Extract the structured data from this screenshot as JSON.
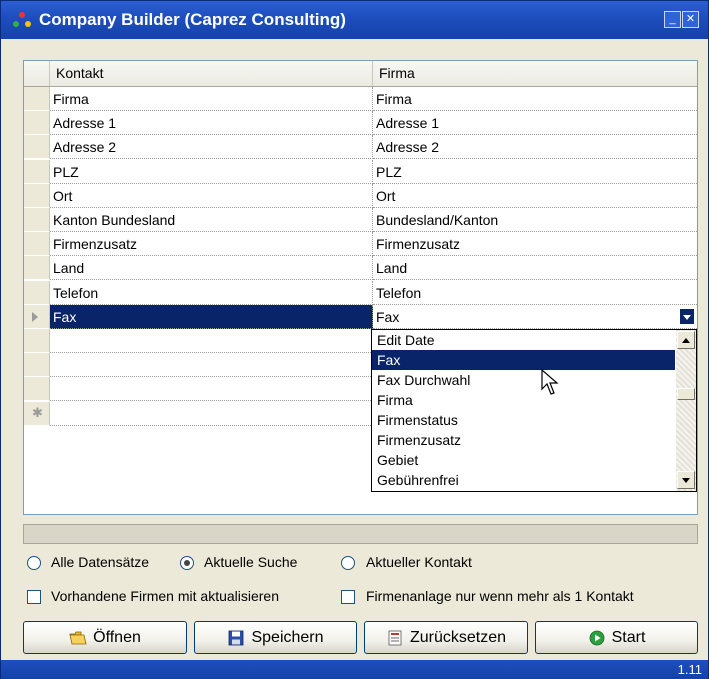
{
  "window": {
    "title": "Company Builder (Caprez Consulting)",
    "version": "1.11"
  },
  "grid": {
    "columns": [
      "Kontakt",
      "Firma"
    ],
    "rows": [
      {
        "kontakt": "Firma",
        "firma": "Firma"
      },
      {
        "kontakt": "Adresse 1",
        "firma": "Adresse 1"
      },
      {
        "kontakt": "Adresse 2",
        "firma": "Adresse 2"
      },
      {
        "kontakt": "PLZ",
        "firma": "PLZ"
      },
      {
        "kontakt": "Ort",
        "firma": "Ort"
      },
      {
        "kontakt": "Kanton Bundesland",
        "firma": "Bundesland/Kanton"
      },
      {
        "kontakt": "Firmenzusatz",
        "firma": "Firmenzusatz"
      },
      {
        "kontakt": "Land",
        "firma": "Land"
      },
      {
        "kontakt": "Telefon",
        "firma": "Telefon"
      },
      {
        "kontakt": "Fax",
        "firma": "Fax"
      },
      {
        "kontakt": "",
        "firma": ""
      },
      {
        "kontakt": "",
        "firma": ""
      },
      {
        "kontakt": "",
        "firma": ""
      },
      {
        "kontakt": "",
        "firma": ""
      }
    ],
    "selected_row": 9
  },
  "dropdown": {
    "options": [
      "Edit Date",
      "Fax",
      "Fax Durchwahl",
      "Firma",
      "Firmenstatus",
      "Firmenzusatz",
      "Gebiet",
      "Gebührenfrei"
    ],
    "highlighted": "Fax"
  },
  "options": {
    "radio_all": "Alle Datensätze",
    "radio_search": "Aktuelle Suche",
    "radio_contact": "Aktueller Kontakt",
    "selected_radio": "Aktuelle Suche",
    "check_update": "Vorhandene Firmen mit aktualisieren",
    "check_multi": "Firmenanlage nur wenn mehr als 1 Kontakt"
  },
  "buttons": {
    "open": "Öffnen",
    "save": "Speichern",
    "reset": "Zurücksetzen",
    "start": "Start"
  },
  "colors": {
    "titlebar": "#1f4fbf",
    "selection": "#0a246a",
    "window_bg": "#ece9d8"
  }
}
